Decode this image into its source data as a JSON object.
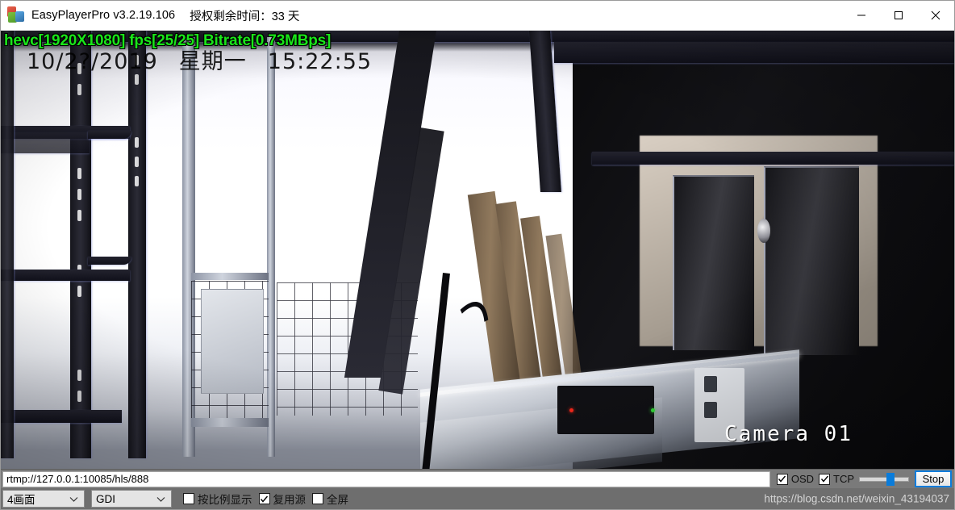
{
  "titlebar": {
    "app_icon": "app-tiles-icon",
    "title": "EasyPlayerPro v3.2.19.106",
    "license": "授权剩余时间：33 天",
    "minimize": "minimize-icon",
    "maximize": "maximize-icon",
    "close": "close-icon"
  },
  "video": {
    "osd_stats": "hevc[1920X1080] fps[25/25] Bitrate[0.73MBps]",
    "osd_date": "10/2?/2019",
    "osd_weekday": "星期一",
    "osd_time": "15:22:55",
    "camera_label": "Camera 01"
  },
  "statusbar": {
    "url": "rtmp://127.0.0.1:10085/hls/888",
    "url_placeholder": "rtmp://",
    "osd_label": "OSD",
    "osd_checked": true,
    "tcp_label": "TCP",
    "tcp_checked": true,
    "volume_value": 55,
    "stop_label": "Stop"
  },
  "toolbar": {
    "layout_select": "4画面",
    "render_select": "GDI",
    "checkboxes": [
      {
        "label": "按比例显示",
        "checked": false
      },
      {
        "label": "复用源",
        "checked": true
      },
      {
        "label": "全屏",
        "checked": false
      }
    ],
    "watermark": "https://blog.csdn.net/weixin_43194037"
  },
  "colors": {
    "osd_green": "#19e619",
    "accent_blue": "#0a7cdb",
    "toolbar_gray": "#6e6e6e",
    "statusbar_gray": "#7a7a7a"
  }
}
